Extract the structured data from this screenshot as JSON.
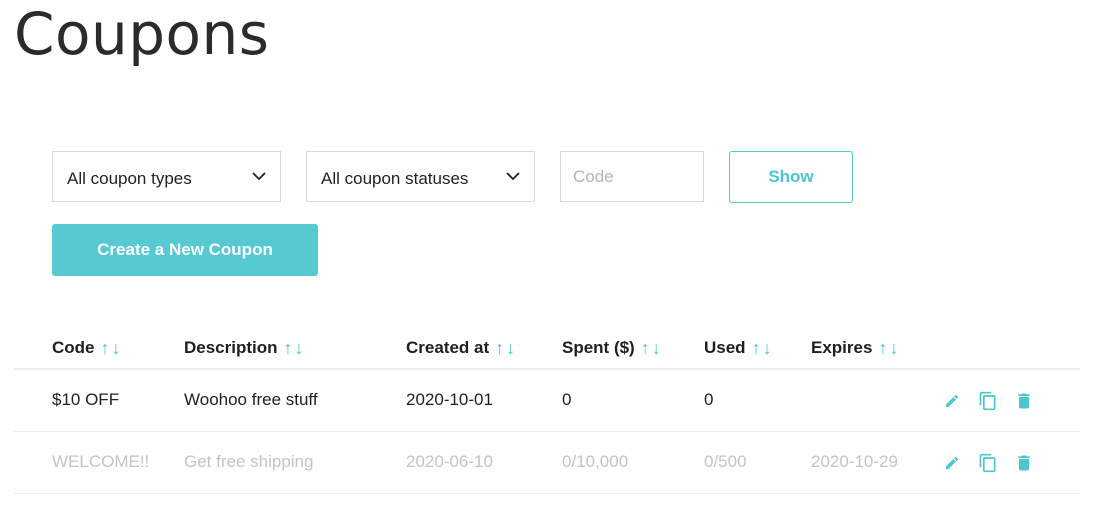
{
  "page": {
    "title": "Coupons"
  },
  "filters": {
    "type_select": {
      "value": "All coupon types"
    },
    "status_select": {
      "value": "All coupon statuses"
    },
    "code_input": {
      "placeholder": "Code",
      "value": ""
    },
    "show_label": "Show"
  },
  "create_label": "Create a New Coupon",
  "table": {
    "headers": [
      "Code",
      "Description",
      "Created at",
      "Spent ($)",
      "Used",
      "Expires"
    ],
    "sort_up": "↑",
    "sort_down": "↓",
    "rows": [
      {
        "code": "$10 OFF",
        "description": "Woohoo free stuff",
        "created_at": "2020-10-01",
        "spent": "0",
        "used": "0",
        "expires": "",
        "status": "active"
      },
      {
        "code": "WELCOME!!",
        "description": "Get free shipping",
        "created_at": "2020-06-10",
        "spent": "0/10,000",
        "used": "0/500",
        "expires": "2020-10-29",
        "status": "inactive"
      }
    ],
    "row_actions": [
      "pencil-icon",
      "copy-icon",
      "trash-icon"
    ]
  },
  "colors": {
    "accent": "#56c9d3",
    "inactive_text": "#c4c4c4",
    "border": "#d9d9d9"
  }
}
